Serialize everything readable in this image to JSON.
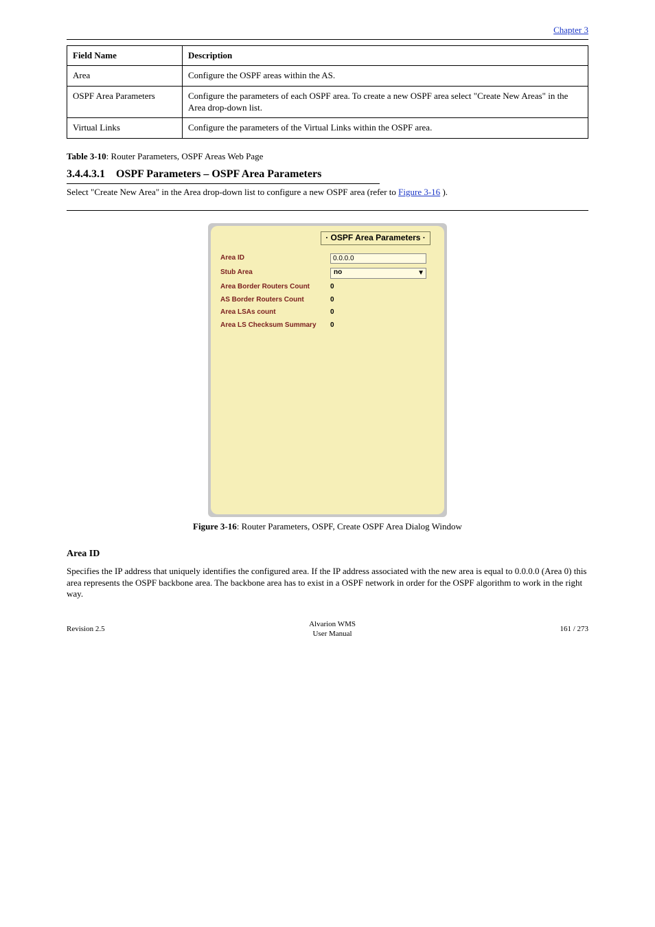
{
  "top_link": {
    "label": "Chapter 3"
  },
  "table": {
    "headers": {
      "name": "Field Name",
      "desc": "Description"
    },
    "rows": [
      {
        "name": "Area",
        "desc": "Configure the OSPF areas within the AS."
      },
      {
        "name": "OSPF Area Parameters",
        "desc": "Configure the parameters of each OSPF area. To create a new OSPF area select \"Create New Areas\" in the Area drop-down list."
      },
      {
        "name": "Virtual Links",
        "desc": "Configure the parameters of the Virtual Links within the OSPF area."
      }
    ]
  },
  "table_caption": {
    "prefix": "Table 3-10",
    "text": ": Router Parameters, OSPF Areas Web Page"
  },
  "section": {
    "number": "3.4.4.3.1",
    "title": "OSPF Parameters – OSPF Area Parameters",
    "body_1_part1": "Select \"Create New Area\" in the Area drop-down list to configure a new OSPF area (refer to ",
    "body_1_link": "Figure 3-16",
    "body_1_part2": ")."
  },
  "panel": {
    "title": "· OSPF Area Parameters ·",
    "rows": [
      {
        "label": "Area ID",
        "type": "input",
        "value": "0.0.0.0"
      },
      {
        "label": "Stub Area",
        "type": "select",
        "value": "no"
      },
      {
        "label": "Area Border Routers Count",
        "type": "text",
        "value": "0"
      },
      {
        "label": "AS Border Routers Count",
        "type": "text",
        "value": "0"
      },
      {
        "label": "Area LSAs count",
        "type": "text",
        "value": "0"
      },
      {
        "label": "Area LS Checksum Summary",
        "type": "text",
        "value": "0"
      }
    ]
  },
  "figure_caption": {
    "prefix": "Figure 3-16",
    "text": ": Router Parameters, OSPF, Create OSPF Area Dialog Window"
  },
  "sub_section": {
    "title": "Area ID",
    "body": "Specifies the IP address that uniquely identifies the configured area. If the IP address associated with the new area is equal to 0.0.0.0 (Area 0) this area represents the OSPF backbone area. The backbone area has to exist in a OSPF network in order for the OSPF algorithm to work in the right way."
  },
  "footer": {
    "left": "Revision 2.5",
    "mid_line1": "Alvarion WMS",
    "mid_line2": "User Manual",
    "right": "161 / 273"
  }
}
